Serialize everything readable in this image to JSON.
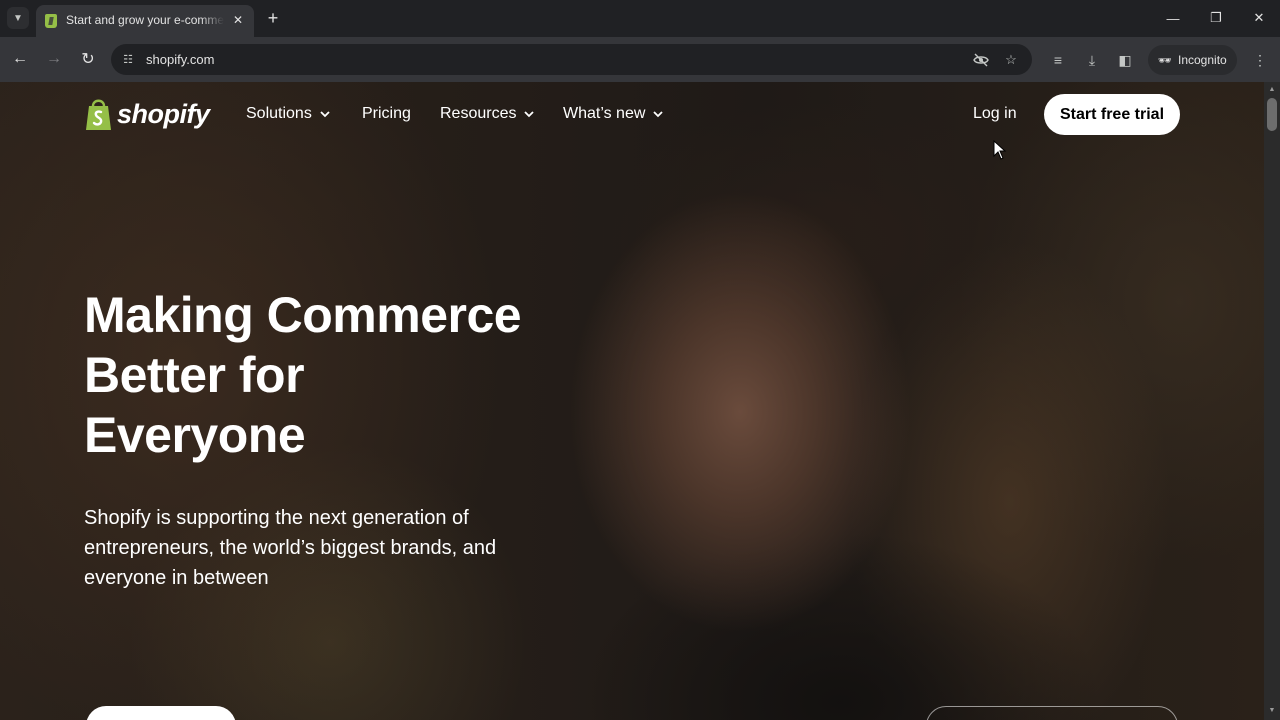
{
  "browser": {
    "tab_title": "Start and grow your e-commerce",
    "url": "shopify.com",
    "incognito_label": "Incognito",
    "icons": {
      "tab_search": "chevron-down-icon",
      "favicon": "shopify-bag-icon",
      "tab_close": "close-icon",
      "new_tab": "plus-icon",
      "minimize": "minimize-icon",
      "restore": "restore-icon",
      "close_window": "close-icon",
      "back": "arrow-left-icon",
      "forward": "arrow-right-icon",
      "reload": "reload-icon",
      "site_info": "tune-icon",
      "tracking": "eye-off-icon",
      "bookmark": "star-icon",
      "media": "playlist-icon",
      "download": "download-icon",
      "side_panel": "side-panel-icon",
      "incognito": "incognito-icon",
      "menu": "more-vert-icon"
    }
  },
  "site": {
    "logo_text": "shopify",
    "nav": {
      "solutions": "Solutions",
      "pricing": "Pricing",
      "resources": "Resources",
      "whats_new": "What’s new"
    },
    "login_label": "Log in",
    "cta_label": "Start free trial"
  },
  "hero": {
    "headline_lines": [
      "Making Commerce",
      "Better for",
      "Everyone"
    ],
    "subhead": "Shopify is supporting the next generation of entrepreneurs, the world’s biggest brands, and everyone in between"
  },
  "colors": {
    "brand_green": "#95bf47",
    "chrome_dark": "#202124",
    "chrome_toolbar": "#35363a",
    "cta_bg": "#ffffff"
  }
}
